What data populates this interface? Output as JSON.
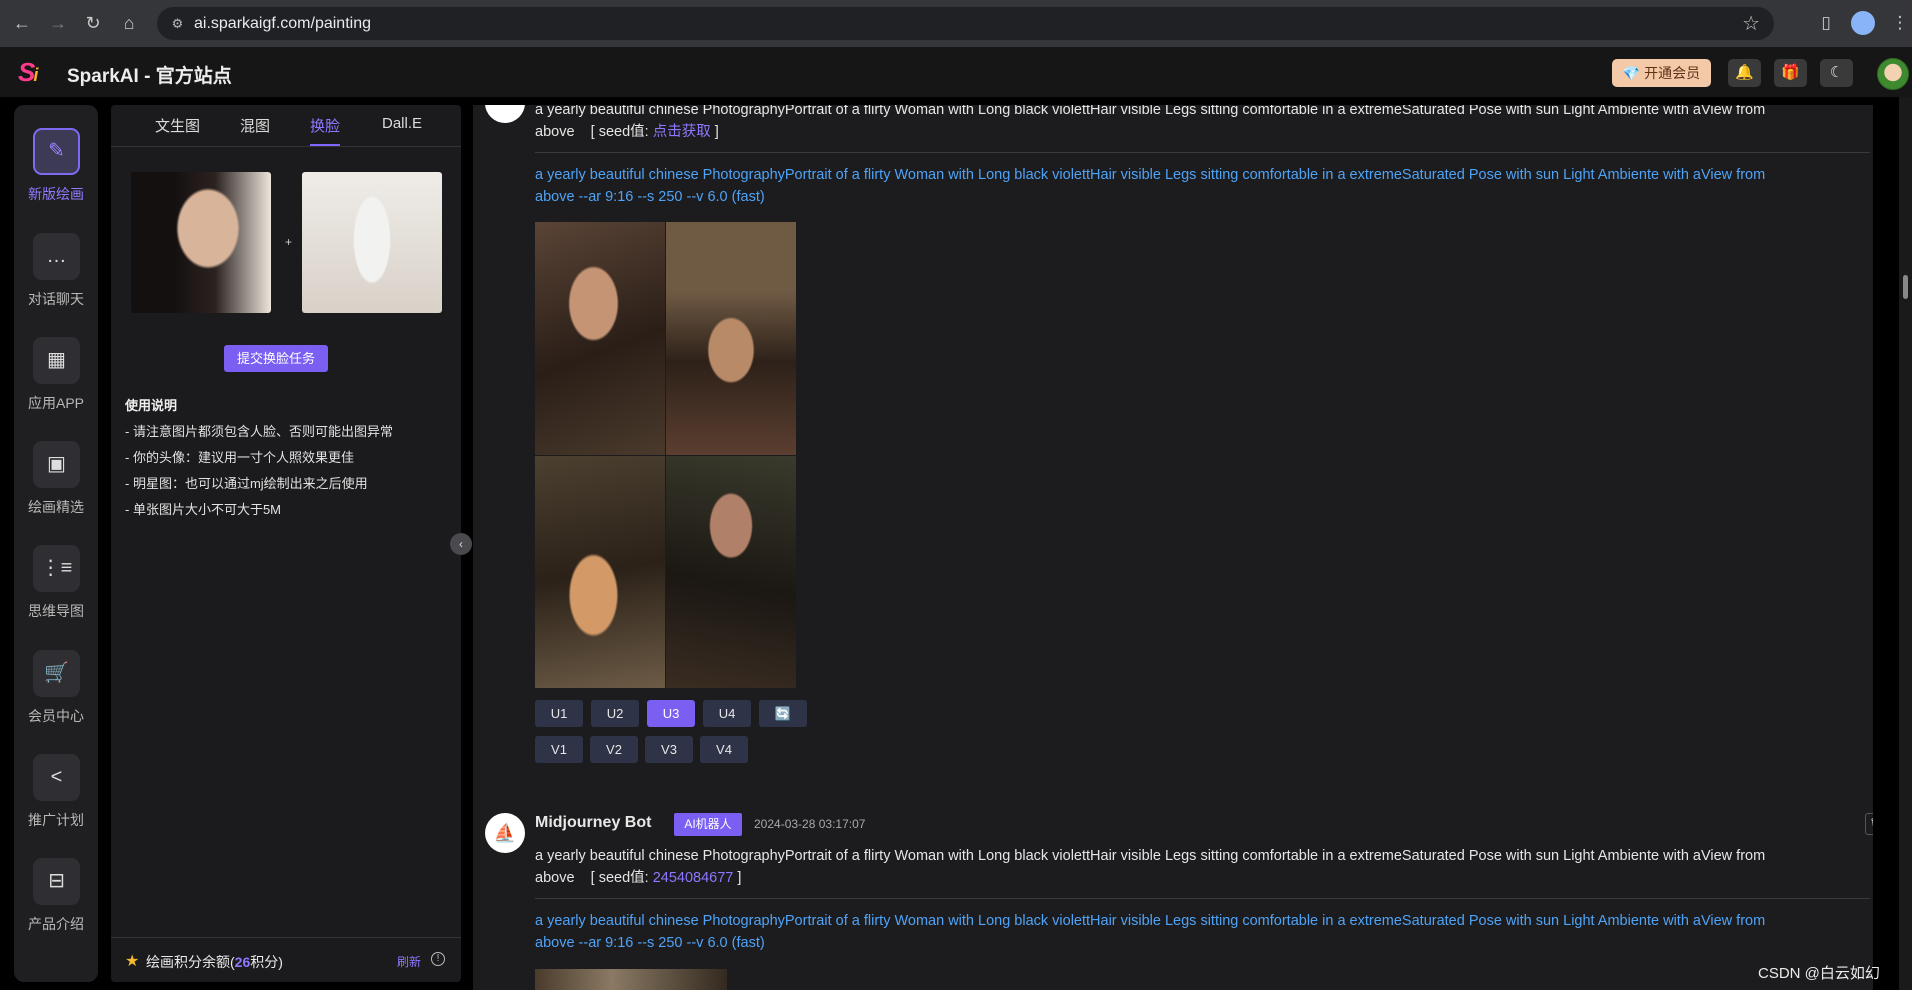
{
  "browser": {
    "url": "ai.sparkaigf.com/painting"
  },
  "header": {
    "logo_text": "S",
    "logo_sub": "i",
    "title": "SparkAI - 官方站点",
    "vip_label": "开通会员",
    "brand_color": "#7a5ff2"
  },
  "rail": {
    "items": [
      {
        "label": "新版绘画",
        "icon": "brush-icon",
        "glyph": "✎"
      },
      {
        "label": "对话聊天",
        "icon": "chat-icon",
        "glyph": "…"
      },
      {
        "label": "应用APP",
        "icon": "apps-grid-icon",
        "glyph": "▦"
      },
      {
        "label": "绘画精选",
        "icon": "gallery-icon",
        "glyph": "▣"
      },
      {
        "label": "思维导图",
        "icon": "mindmap-icon",
        "glyph": "⋮≡"
      },
      {
        "label": "会员中心",
        "icon": "cart-icon",
        "glyph": "🛒"
      },
      {
        "label": "推广计划",
        "icon": "share-icon",
        "glyph": "<"
      },
      {
        "label": "产品介绍",
        "icon": "product-icon",
        "glyph": "⊟"
      }
    ]
  },
  "panel": {
    "tabs": [
      "文生图",
      "混图",
      "换脸",
      "Dall.E"
    ],
    "active_tab": "换脸",
    "plus": "+",
    "submit_label": "提交换脸任务",
    "usage_title": "使用说明",
    "usage_lines": [
      "- 请注意图片都须包含人脸、否则可能出图异常",
      "- 你的头像：建议用一寸个人照效果更佳",
      "- 明星图：也可以通过mj绘制出来之后使用",
      "- 单张图片大小不可大于5M"
    ],
    "credits_prefix": "绘画积分余额(",
    "credits_value": "26",
    "credits_suffix": "积分)",
    "refresh_label": "刷新",
    "info_glyph": "!"
  },
  "feed": {
    "msg1": {
      "prompt_line1": "a yearly beautiful chinese PhotographyPortrait of a flirty Woman with Long black violettHair visible Legs sitting comfortable in a extremeSaturated Pose with sun Light Ambiente with aView from",
      "prompt_line2": "above",
      "seed_prefix": "[ seed值: ",
      "seed_value": "点击获取",
      "seed_suffix": " ]",
      "full_prompt_line1": "a yearly beautiful chinese PhotographyPortrait of a flirty Woman with Long black violettHair visible Legs sitting comfortable in a extremeSaturated Pose with sun Light Ambiente with aView from",
      "full_prompt_line2": "above --ar 9:16 --s 250 --v 6.0  (fast)",
      "upscale_buttons": [
        "U1",
        "U2",
        "U3",
        "U4"
      ],
      "active_upscale": "U3",
      "reroll_glyph": "🔄",
      "variation_buttons": [
        "V1",
        "V2",
        "V3",
        "V4"
      ]
    },
    "msg2": {
      "bot_name": "Midjourney Bot",
      "badge": "AI机器人",
      "time": "2024-03-28 03:17:07",
      "prompt_line1": "a yearly beautiful chinese PhotographyPortrait of a flirty Woman with Long black violettHair visible Legs sitting comfortable in a extremeSaturated Pose with sun Light Ambiente with aView from",
      "prompt_line2": "above",
      "seed_prefix": "[ seed值: ",
      "seed_value": "2454084677",
      "seed_suffix": " ]",
      "full_prompt_line1": "a yearly beautiful chinese PhotographyPortrait of a flirty Woman with Long black violettHair visible Legs sitting comfortable in a extremeSaturated Pose with sun Light Ambiente with aView from",
      "full_prompt_line2": "above --ar 9:16 --s 250 --v 6.0  (fast)"
    }
  },
  "watermark": "CSDN @白云如幻"
}
